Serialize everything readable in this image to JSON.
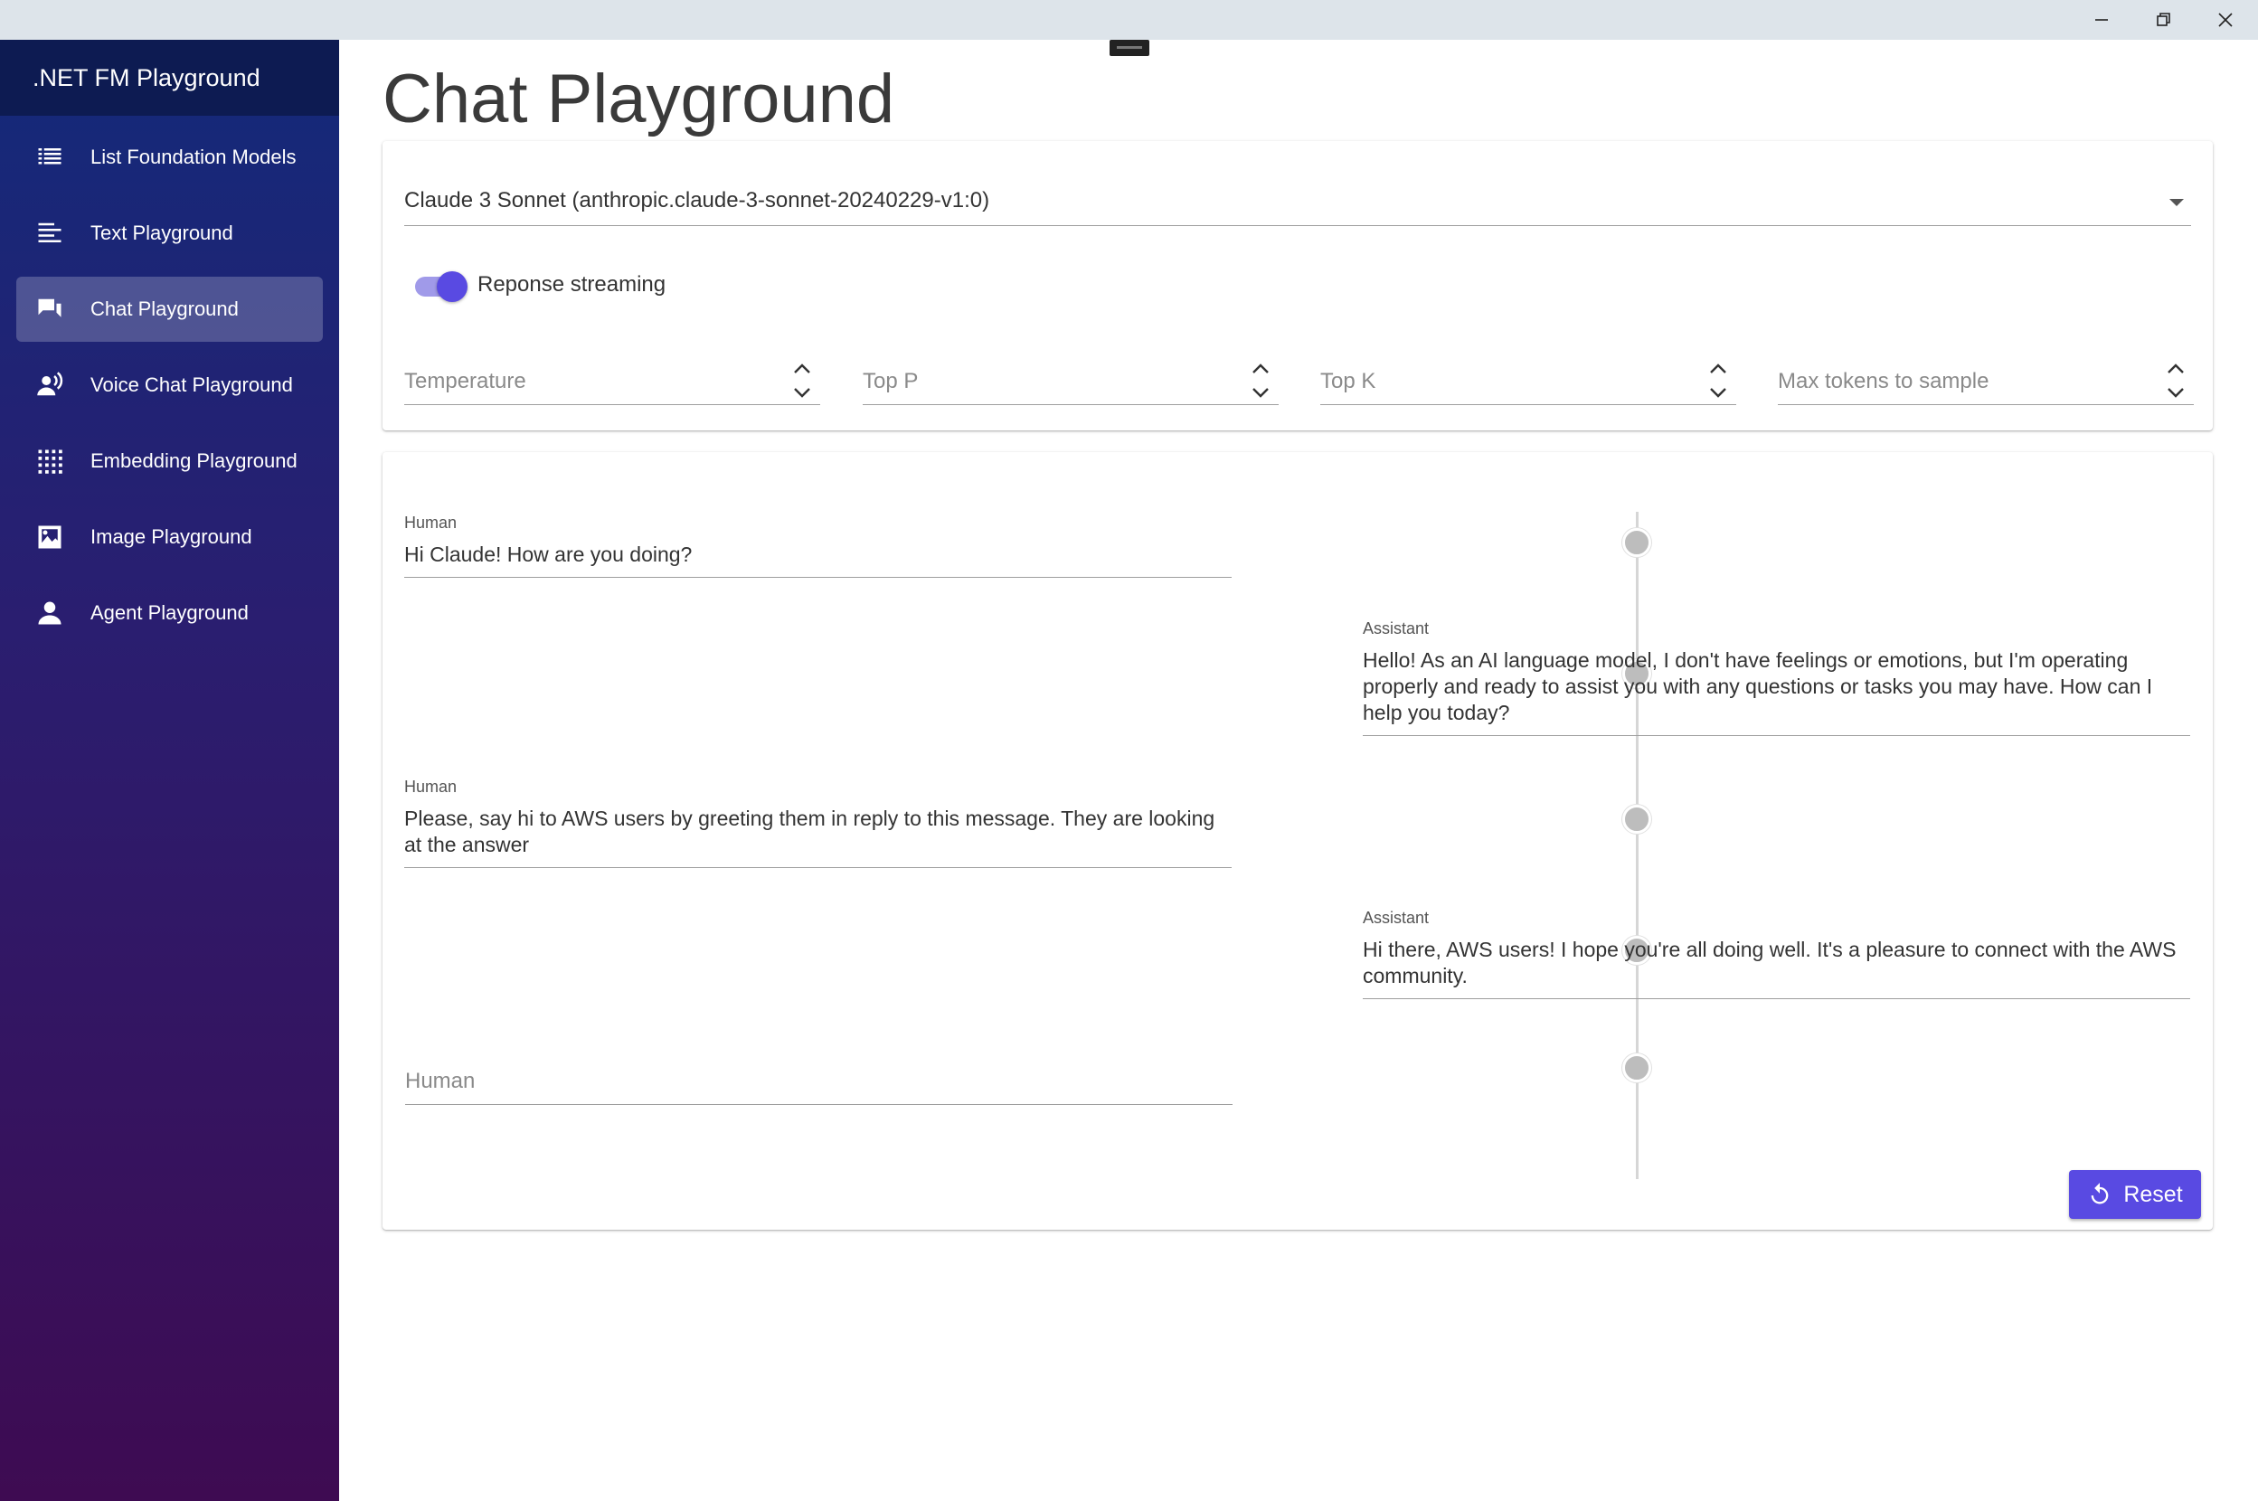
{
  "sidebar": {
    "brand": ".NET FM Playground",
    "items": [
      {
        "label": "List Foundation Models",
        "icon": "list-icon",
        "active": false
      },
      {
        "label": "Text Playground",
        "icon": "text-lines-icon",
        "active": false
      },
      {
        "label": "Chat Playground",
        "icon": "chat-icon",
        "active": true
      },
      {
        "label": "Voice Chat Playground",
        "icon": "voice-chat-icon",
        "active": false
      },
      {
        "label": "Embedding Playground",
        "icon": "grid-dots-icon",
        "active": false
      },
      {
        "label": "Image Playground",
        "icon": "image-icon",
        "active": false
      },
      {
        "label": "Agent Playground",
        "icon": "person-icon",
        "active": false
      }
    ]
  },
  "main": {
    "title": "Chat Playground",
    "model_select": {
      "value": "Claude 3 Sonnet (anthropic.claude-3-sonnet-20240229-v1:0)"
    },
    "streaming": {
      "label": "Reponse streaming",
      "enabled": true
    },
    "params": [
      {
        "placeholder": "Temperature"
      },
      {
        "placeholder": "Top P"
      },
      {
        "placeholder": "Top K"
      },
      {
        "placeholder": "Max tokens to sample"
      }
    ],
    "messages": [
      {
        "role": "Human",
        "text": "Hi Claude! How are you doing?"
      },
      {
        "role": "Assistant",
        "text": "Hello! As an AI language model, I don't have feelings or emotions, but I'm operating properly and ready to assist you with any questions or tasks you may have. How can I help you today?"
      },
      {
        "role": "Human",
        "text": "Please, say hi to AWS users by greeting them in reply to this message. They are looking at the answer"
      },
      {
        "role": "Assistant",
        "text": "Hi there, AWS users! I hope you're all doing well. It's a pleasure to connect with the AWS community."
      }
    ],
    "input_placeholder": "Human",
    "reset_label": "Reset"
  },
  "colors": {
    "accent": "#594ae2",
    "sidebar_top": "#132a7a",
    "sidebar_bottom": "#3e0b52",
    "brand_bar": "#0d1b52"
  }
}
